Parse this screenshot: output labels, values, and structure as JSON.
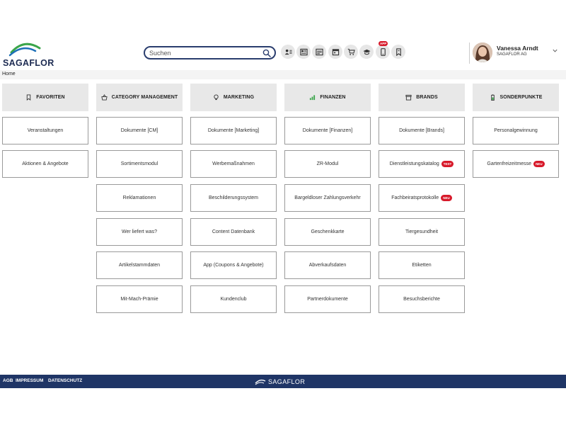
{
  "header": {
    "brand": "SAGAFLOR",
    "search": {
      "placeholder": "Suchen",
      "value": ""
    },
    "toolbar_icons": [
      "contacts-icon",
      "news-icon",
      "calendar-list-icon",
      "calendar-icon",
      "cart-icon",
      "academy-icon",
      "app-icon",
      "bookmark-icon"
    ],
    "app_badge": "APP",
    "user": {
      "name": "Vanessa Arndt",
      "company": "SAGAFLOR AG"
    }
  },
  "breadcrumb": "Home",
  "columns": [
    {
      "title": "FAVORITEN",
      "icon": "bookmark-icon",
      "tiles": [
        {
          "label": "Veranstaltungen"
        },
        {
          "label": "Aktionen & Angebote"
        }
      ]
    },
    {
      "title": "CATEGORY MANAGEMENT",
      "icon": "basket-icon",
      "tiles": [
        {
          "label": "Dokumente [CM]"
        },
        {
          "label": "Sortimentsmodul"
        },
        {
          "label": "Reklamationen"
        },
        {
          "label": "Wer liefert was?"
        },
        {
          "label": "Artikelstammdaten"
        },
        {
          "label": "Mit-Mach-Prämie"
        }
      ]
    },
    {
      "title": "MARKETING",
      "icon": "lightbulb-icon",
      "tiles": [
        {
          "label": "Dokumente [Marketing]"
        },
        {
          "label": "Werbemaßnahmen"
        },
        {
          "label": "Beschilderungssystem"
        },
        {
          "label": "Content Datenbank"
        },
        {
          "label": "App (Coupons & Angebote)"
        },
        {
          "label": "Kundenclub"
        }
      ]
    },
    {
      "title": "FINANZEN",
      "icon": "bar-chart-icon",
      "tiles": [
        {
          "label": "Dokumente [Finanzen]"
        },
        {
          "label": "ZR-Modul"
        },
        {
          "label": "Bargeldloser Zahlungsverkehr"
        },
        {
          "label": "Geschenkkarte"
        },
        {
          "label": "Abverkaufsdaten"
        },
        {
          "label": "Partnerdokumente"
        }
      ]
    },
    {
      "title": "BRANDS",
      "icon": "store-icon",
      "tiles": [
        {
          "label": "Dokumente [Brands]"
        },
        {
          "label": "Dienstleistungskatalog",
          "badge": "TEST"
        },
        {
          "label": "Fachbeiratsprotokolle",
          "badge": "NEU"
        },
        {
          "label": "Tiergesundheit"
        },
        {
          "label": "Etiketten"
        },
        {
          "label": "Besuchsberichte"
        }
      ]
    },
    {
      "title": "SONDERPUNKTE",
      "icon": "battery-icon",
      "tiles": [
        {
          "label": "Personalgewinnung"
        },
        {
          "label": "Gartenfreizeitmesse",
          "badge": "NEU"
        }
      ]
    }
  ],
  "footer": {
    "links": [
      "AGB",
      "IMPRESSUM",
      "DATENSCHUTZ"
    ],
    "brand": "SAGAFLOR"
  },
  "colors": {
    "navy": "#1f3566",
    "badge_red": "#d7192a",
    "logo_green": "#3aa54a",
    "logo_blue": "#1d6fb8"
  }
}
